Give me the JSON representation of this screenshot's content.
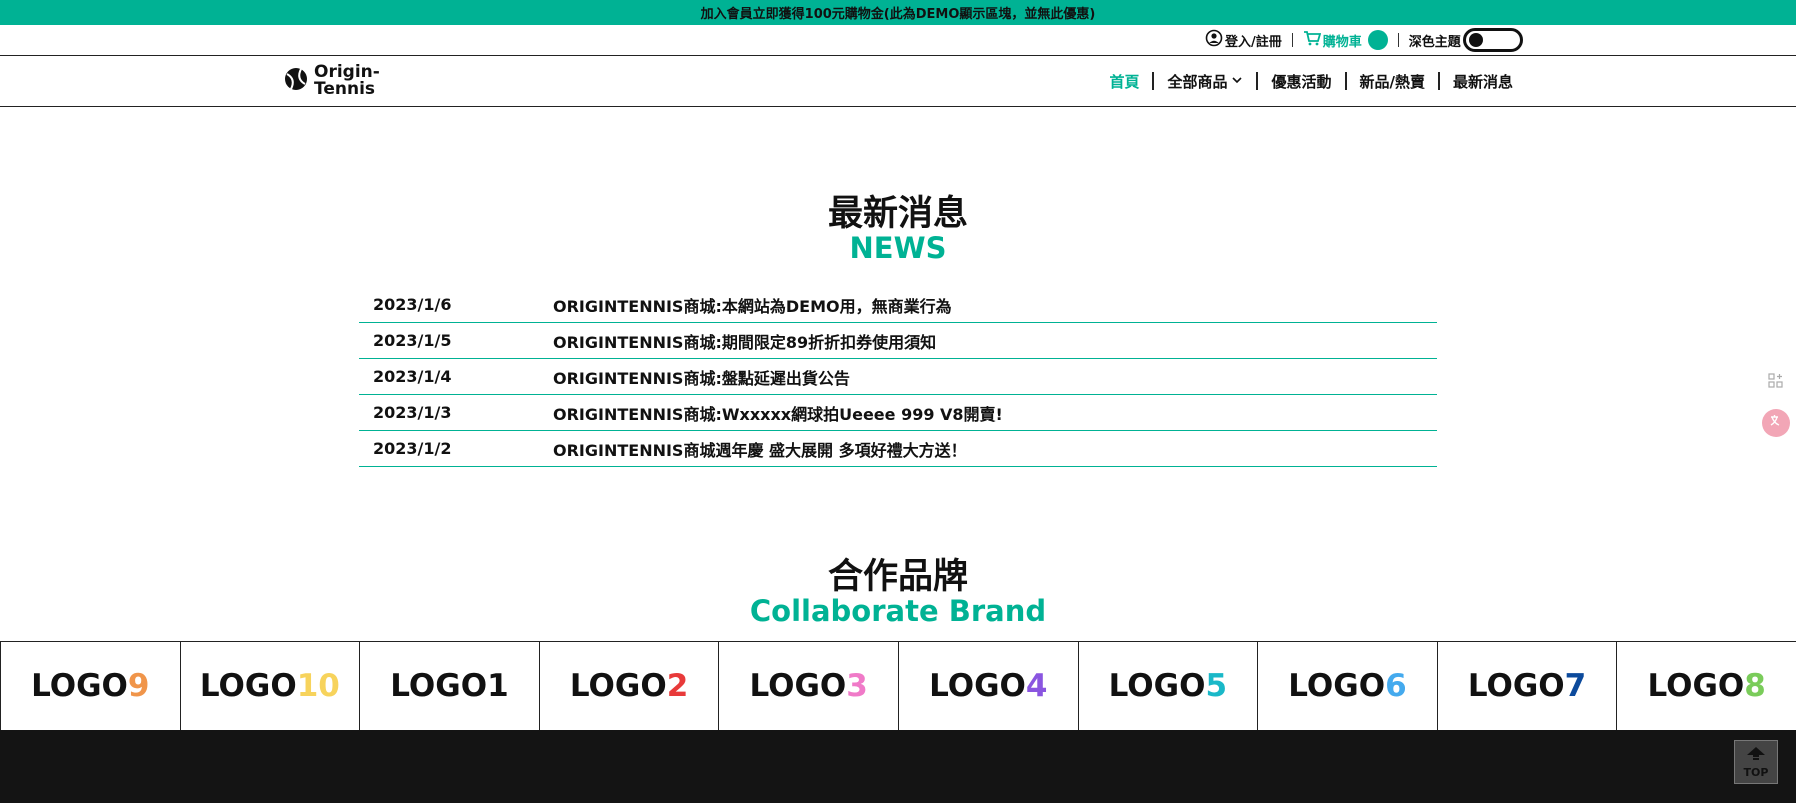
{
  "announcement": "加入會員立即獲得100元購物金(此為DEMO顯示區塊，並無此優惠)",
  "utility": {
    "login_label": "登入/註冊",
    "cart_label": "購物車",
    "theme_label": "深色主題"
  },
  "logo": {
    "line1": "Origin-",
    "line2": "Tennis"
  },
  "nav": {
    "items": [
      {
        "label": "首頁",
        "active": true
      },
      {
        "label": "全部商品",
        "dropdown": true
      },
      {
        "label": "優惠活動"
      },
      {
        "label": "新品/熱賣"
      },
      {
        "label": "最新消息"
      }
    ]
  },
  "news": {
    "title_zh": "最新消息",
    "title_en": "NEWS",
    "items": [
      {
        "date": "2023/1/6",
        "title": "ORIGINTENNIS商城:本網站為DEMO用，無商業行為"
      },
      {
        "date": "2023/1/5",
        "title": "ORIGINTENNIS商城:期間限定89折折扣券使用須知"
      },
      {
        "date": "2023/1/4",
        "title": "ORIGINTENNIS商城:盤點延遲出貨公告"
      },
      {
        "date": "2023/1/3",
        "title": "ORIGINTENNIS商城:Wxxxxx網球拍Ueeee 999 V8開賣!"
      },
      {
        "date": "2023/1/2",
        "title": "ORIGINTENNIS商城週年慶 盛大展開 多項好禮大方送！"
      }
    ]
  },
  "brands": {
    "title_zh": "合作品牌",
    "title_en": "Collaborate Brand",
    "items": [
      {
        "word": "LOGO ",
        "num": "9",
        "color": "#f0954a"
      },
      {
        "word": "LOGO ",
        "num": "10",
        "color": "#f7d35c"
      },
      {
        "word": "LOGO ",
        "num": "1",
        "color": "#111111"
      },
      {
        "word": "LOGO ",
        "num": "2",
        "color": "#e83a3a"
      },
      {
        "word": "LOGO ",
        "num": "3",
        "color": "#f07ac8"
      },
      {
        "word": "LOGO ",
        "num": "4",
        "color": "#8a55e0"
      },
      {
        "word": "LOGO ",
        "num": "5",
        "color": "#1ab8c8"
      },
      {
        "word": "LOGO ",
        "num": "6",
        "color": "#44aaee"
      },
      {
        "word": "LOGO ",
        "num": "7",
        "color": "#0c4a9c"
      },
      {
        "word": "LOGO ",
        "num": "8",
        "color": "#7acc5a"
      }
    ]
  },
  "top_button": "TOP",
  "colors": {
    "accent": "#00b294",
    "footer": "#141414"
  }
}
